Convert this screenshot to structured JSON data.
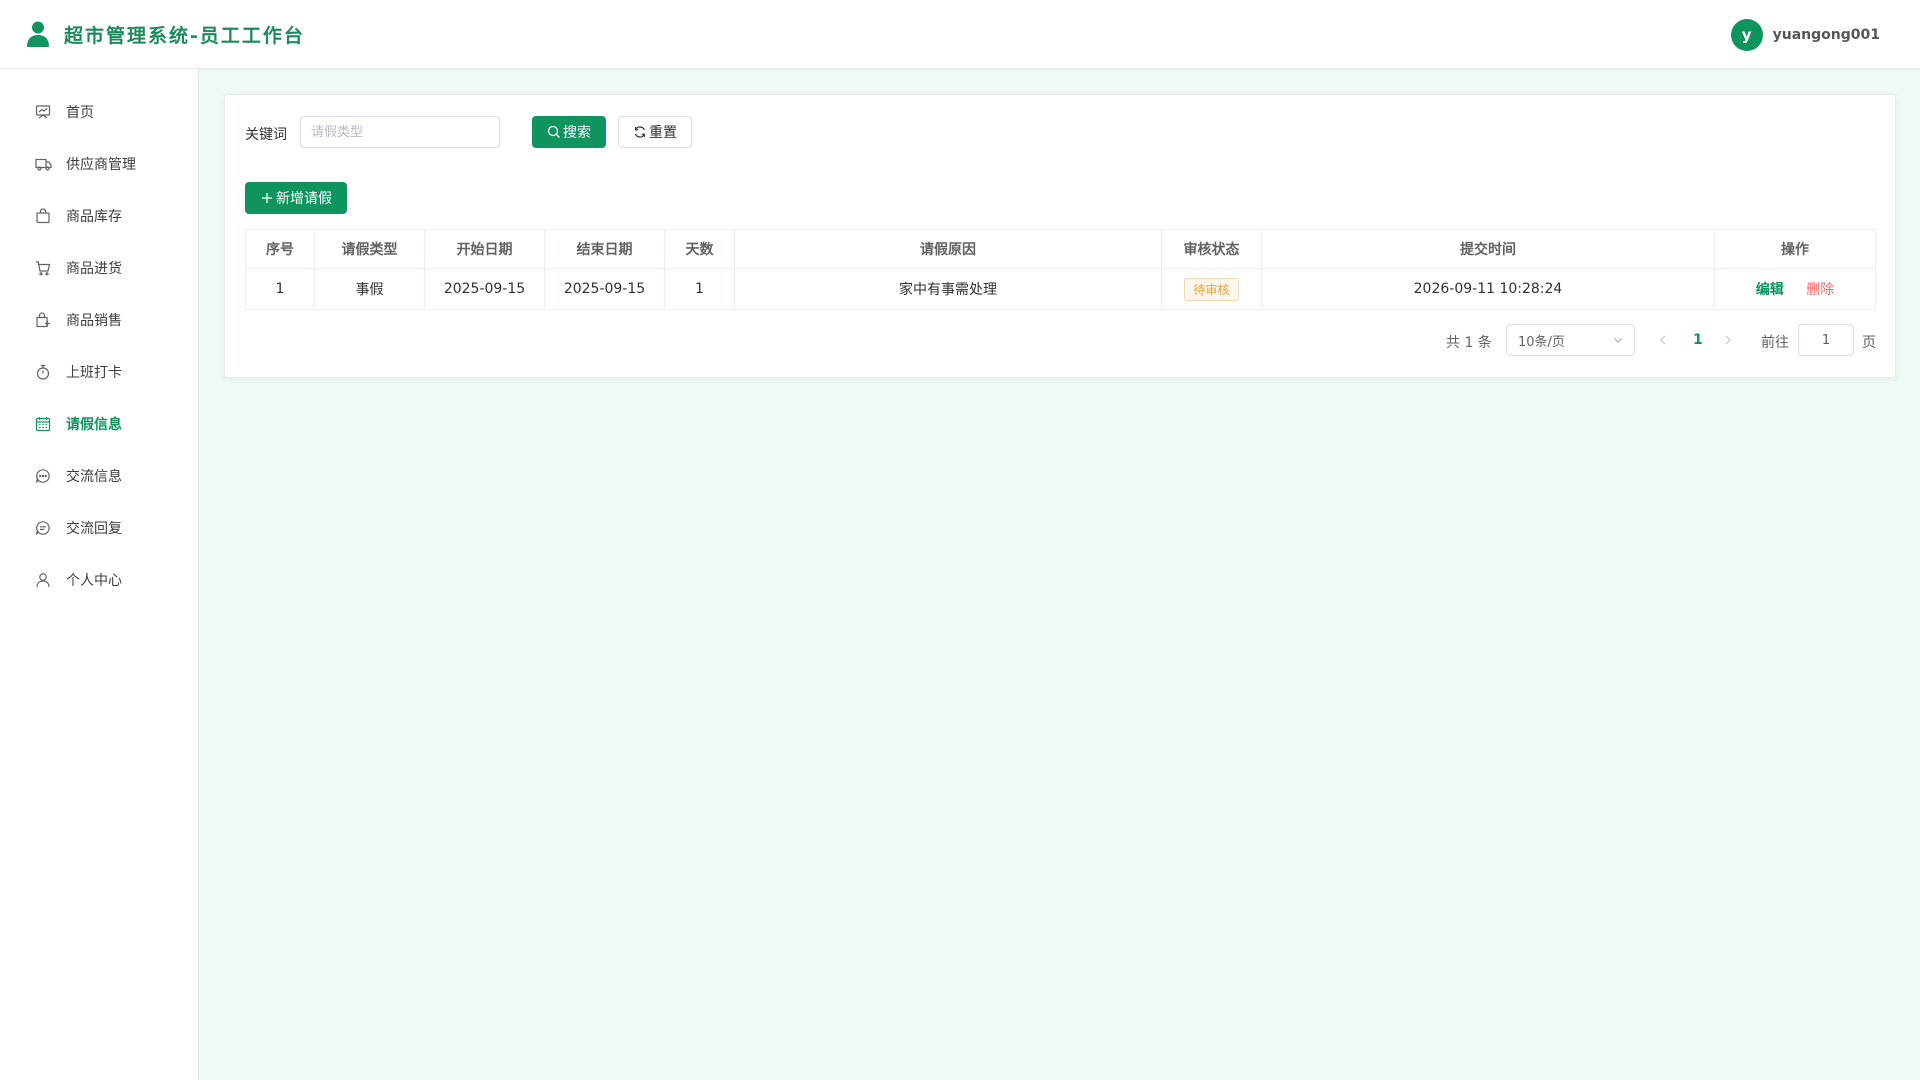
{
  "header": {
    "title": "超市管理系统-员工工作台",
    "avatar_letter": "y",
    "username": "yuangong001"
  },
  "sidebar": {
    "items": [
      {
        "label": "首页",
        "icon": "dashboard-icon"
      },
      {
        "label": "供应商管理",
        "icon": "truck-icon"
      },
      {
        "label": "商品库存",
        "icon": "bag-icon"
      },
      {
        "label": "商品进货",
        "icon": "cart-icon"
      },
      {
        "label": "商品销售",
        "icon": "shopping-bag-icon"
      },
      {
        "label": "上班打卡",
        "icon": "stopwatch-icon"
      },
      {
        "label": "请假信息",
        "icon": "calendar-icon",
        "active": true
      },
      {
        "label": "交流信息",
        "icon": "chat-dots-icon"
      },
      {
        "label": "交流回复",
        "icon": "chat-lines-icon"
      },
      {
        "label": "个人中心",
        "icon": "user-icon"
      }
    ]
  },
  "search": {
    "label": "关键词",
    "placeholder": "请假类型",
    "value": "",
    "search_label": "搜索",
    "reset_label": "重置"
  },
  "toolbar": {
    "add_label": "新增请假"
  },
  "table": {
    "columns": [
      "序号",
      "请假类型",
      "开始日期",
      "结束日期",
      "天数",
      "请假原因",
      "审核状态",
      "提交时间",
      "操作"
    ],
    "rows": [
      {
        "index": "1",
        "type": "事假",
        "start": "2025-09-15",
        "end": "2025-09-15",
        "days": "1",
        "reason": "家中有事需处理",
        "status": "待审核",
        "submitted": "2026-09-11 10:28:24",
        "edit_label": "编辑",
        "delete_label": "删除"
      }
    ]
  },
  "pagination": {
    "total_text": "共 1 条",
    "page_size": "10条/页",
    "current_page": "1",
    "goto_label": "前往",
    "goto_value": "1",
    "page_unit": "页"
  },
  "colors": {
    "primary": "#0f9460",
    "danger": "#f56c6c",
    "warning": "#e6a23c",
    "background": "#eefaf2"
  }
}
